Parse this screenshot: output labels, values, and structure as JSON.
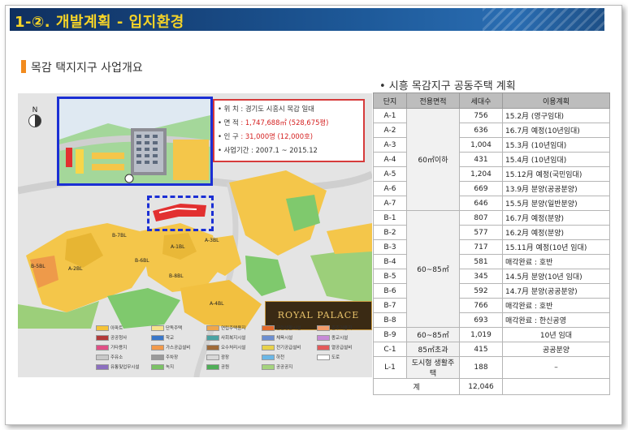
{
  "header": {
    "title": "1-②. 개발계획 - 입지환경"
  },
  "section": {
    "subtitle": "목감 택지지구 사업개요"
  },
  "map": {
    "compass_label": "N",
    "info": {
      "rows": [
        {
          "key": "• 위    치",
          "value": ": 경기도 시흥시 목감 일대"
        },
        {
          "key": "• 면    적",
          "value": ": 1,747,688㎡ (528,675평)"
        },
        {
          "key": "• 인    구",
          "value": ": 31,000명 (12,000호)"
        },
        {
          "key": "• 사업기간",
          "value": ": 2007.1 ~ 2015.12"
        }
      ]
    },
    "parcels": [
      "B-7BL",
      "A-1BL",
      "A-3BL",
      "A-2BL",
      "B-5BL",
      "B-6BL",
      "B-8BL",
      "A-4BL"
    ],
    "logo_text": "ROYAL  PALACE",
    "legend": [
      "아파트",
      "공공청사",
      "기타용지",
      "주유소",
      "유통및업무시설",
      "단독주택",
      "학교",
      "가스공급설비",
      "주차장",
      "녹지",
      "연립주택용지",
      "사회복지시설",
      "오수처리시설",
      "광장",
      "공원",
      "근린생활시설",
      "체육시설",
      "전기공급설비",
      "하천",
      "공공공지",
      "준주거용지",
      "종교시설",
      "열공급설비",
      "도로"
    ],
    "legend_colors": [
      "#f5c338",
      "#b23a3a",
      "#e04f86",
      "#c8c8c8",
      "#8c6fbf",
      "#f7e28a",
      "#3a77c9",
      "#f29a4b",
      "#9a9a9a",
      "#7cc266",
      "#f0a64a",
      "#4aa3a3",
      "#a06b3a",
      "#d8d8d8",
      "#4fae57",
      "#e46b2c",
      "#6c8fd1",
      "#e8d24a",
      "#6bb7e6",
      "#a5d37e",
      "#f39c6b",
      "#c78ad8",
      "#e35a5a",
      "#ffffff"
    ]
  },
  "table": {
    "title": "• 시흥 목감지구 공동주택 계획",
    "headers": [
      "단지",
      "전용면적",
      "세대수",
      "이용계획"
    ],
    "rows": [
      {
        "id": "A-1",
        "area": "60㎡이하",
        "units": "756",
        "plan": "15.2月 (영구임대)"
      },
      {
        "id": "A-2",
        "area": "",
        "units": "636",
        "plan": "16.7月 예정(10년임대)"
      },
      {
        "id": "A-3",
        "area": "",
        "units": "1,004",
        "plan": "15.3月 (10년임대)"
      },
      {
        "id": "A-4",
        "area": "",
        "units": "431",
        "plan": "15.4月 (10년임대)"
      },
      {
        "id": "A-5",
        "area": "",
        "units": "1,204",
        "plan": "15.12月 예정(국민임대)"
      },
      {
        "id": "A-6",
        "area": "",
        "units": "669",
        "plan": "13.9月 분양(공공분양)"
      },
      {
        "id": "A-7",
        "area": "",
        "units": "646",
        "plan": "15.5月 분양(일반분양)"
      },
      {
        "id": "B-1",
        "area": "60~85㎡",
        "units": "807",
        "plan": "16.7月 예정(분양)"
      },
      {
        "id": "B-2",
        "area": "",
        "units": "577",
        "plan": "16.2月 예정(분양)"
      },
      {
        "id": "B-3",
        "area": "",
        "units": "717",
        "plan": "15.11月 예정(10년 임대)"
      },
      {
        "id": "B-4",
        "area": "",
        "units": "581",
        "plan": "매각완료 : 호반"
      },
      {
        "id": "B-5",
        "area": "",
        "units": "345",
        "plan": "14.5月 분양(10년 임대)"
      },
      {
        "id": "B-6",
        "area": "",
        "units": "592",
        "plan": "14.7月 분양(공공분양)"
      },
      {
        "id": "B-7",
        "area": "",
        "units": "766",
        "plan": "매각완료 : 호반"
      },
      {
        "id": "B-8",
        "area": "",
        "units": "693",
        "plan": "매각완료 : 한신공영"
      },
      {
        "id": "B-9",
        "area": "60~85㎡",
        "units": "1,019",
        "plan": "10년 임대"
      },
      {
        "id": "C-1",
        "area": "85㎡초과",
        "units": "415",
        "plan": "공공분양"
      },
      {
        "id": "L-1",
        "area": "도시형 생활주택",
        "units": "188",
        "plan": "–"
      }
    ],
    "total_label": "계",
    "total_units": "12,046"
  },
  "colors": {
    "banner": "#1e5a9a",
    "banner_text": "#f5d327",
    "accent": "#f28b1e",
    "info_border": "#d63b3b",
    "highlight_border": "#1b2fd4"
  }
}
